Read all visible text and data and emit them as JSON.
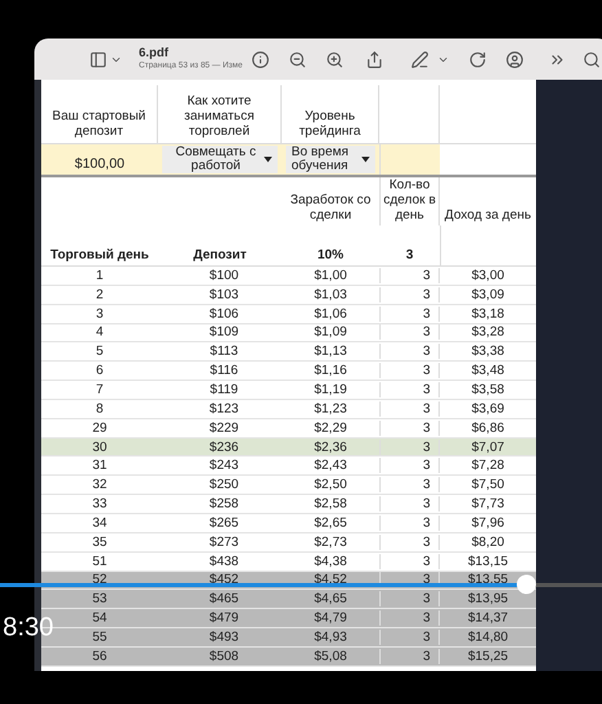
{
  "window": {
    "title": "6.pdf",
    "subtitle": "Страница 53 из 85 — Изме"
  },
  "settings": {
    "headers": [
      "Ваш стартовый депозит",
      "Как хотите заниматься торговлей",
      "Уровень трейдинга"
    ],
    "deposit": "$100,00",
    "mode": "Совмещать с работой",
    "level_select": "Во время обучения"
  },
  "table": {
    "top_headers": [
      "Заработок со сделки",
      "Кол-во сделок в день",
      "Доход за день"
    ],
    "columns": [
      "Торговый день",
      "Депозит",
      "10%",
      "3"
    ],
    "rows": [
      {
        "cells": [
          "1",
          "$100",
          "$1,00",
          "3",
          "$3,00"
        ],
        "kind": "normal"
      },
      {
        "cells": [
          "2",
          "$103",
          "$1,03",
          "3",
          "$3,09"
        ],
        "kind": "normal"
      },
      {
        "cells": [
          "3",
          "$106",
          "$1,06",
          "3",
          "$3,18"
        ],
        "kind": "normal"
      },
      {
        "cells": [
          "4",
          "$109",
          "$1,09",
          "3",
          "$3,28"
        ],
        "kind": "normal"
      },
      {
        "cells": [
          "5",
          "$113",
          "$1,13",
          "3",
          "$3,38"
        ],
        "kind": "normal"
      },
      {
        "cells": [
          "6",
          "$116",
          "$1,16",
          "3",
          "$3,48"
        ],
        "kind": "normal"
      },
      {
        "cells": [
          "7",
          "$119",
          "$1,19",
          "3",
          "$3,58"
        ],
        "kind": "normal"
      },
      {
        "cells": [
          "8",
          "$123",
          "$1,23",
          "3",
          "$3,69"
        ],
        "kind": "normal"
      },
      {
        "cells": [
          "29",
          "$229",
          "$2,29",
          "3",
          "$6,86"
        ],
        "kind": "normal"
      },
      {
        "cells": [
          "30",
          "$236",
          "$2,36",
          "3",
          "$7,07"
        ],
        "kind": "highlight"
      },
      {
        "cells": [
          "31",
          "$243",
          "$2,43",
          "3",
          "$7,28"
        ],
        "kind": "normal"
      },
      {
        "cells": [
          "32",
          "$250",
          "$2,50",
          "3",
          "$7,50"
        ],
        "kind": "normal"
      },
      {
        "cells": [
          "33",
          "$258",
          "$2,58",
          "3",
          "$7,73"
        ],
        "kind": "normal"
      },
      {
        "cells": [
          "34",
          "$265",
          "$2,65",
          "3",
          "$7,96"
        ],
        "kind": "normal"
      },
      {
        "cells": [
          "35",
          "$273",
          "$2,73",
          "3",
          "$8,20"
        ],
        "kind": "normal"
      },
      {
        "cells": [
          "51",
          "$438",
          "$4,38",
          "3",
          "$13,15"
        ],
        "kind": "normal"
      },
      {
        "cells": [
          "52",
          "$452",
          "$4,52",
          "3",
          "$13,55"
        ],
        "kind": "dim"
      },
      {
        "cells": [
          "53",
          "$465",
          "$4,65",
          "3",
          "$13,95"
        ],
        "kind": "dim"
      },
      {
        "cells": [
          "54",
          "$479",
          "$4,79",
          "3",
          "$14,37"
        ],
        "kind": "dim"
      },
      {
        "cells": [
          "55",
          "$493",
          "$4,93",
          "3",
          "$14,80"
        ],
        "kind": "dim"
      },
      {
        "cells": [
          "56",
          "$508",
          "$5,08",
          "3",
          "$15,25"
        ],
        "kind": "dim"
      }
    ]
  },
  "player": {
    "time": "8:30",
    "level": 0.875
  }
}
